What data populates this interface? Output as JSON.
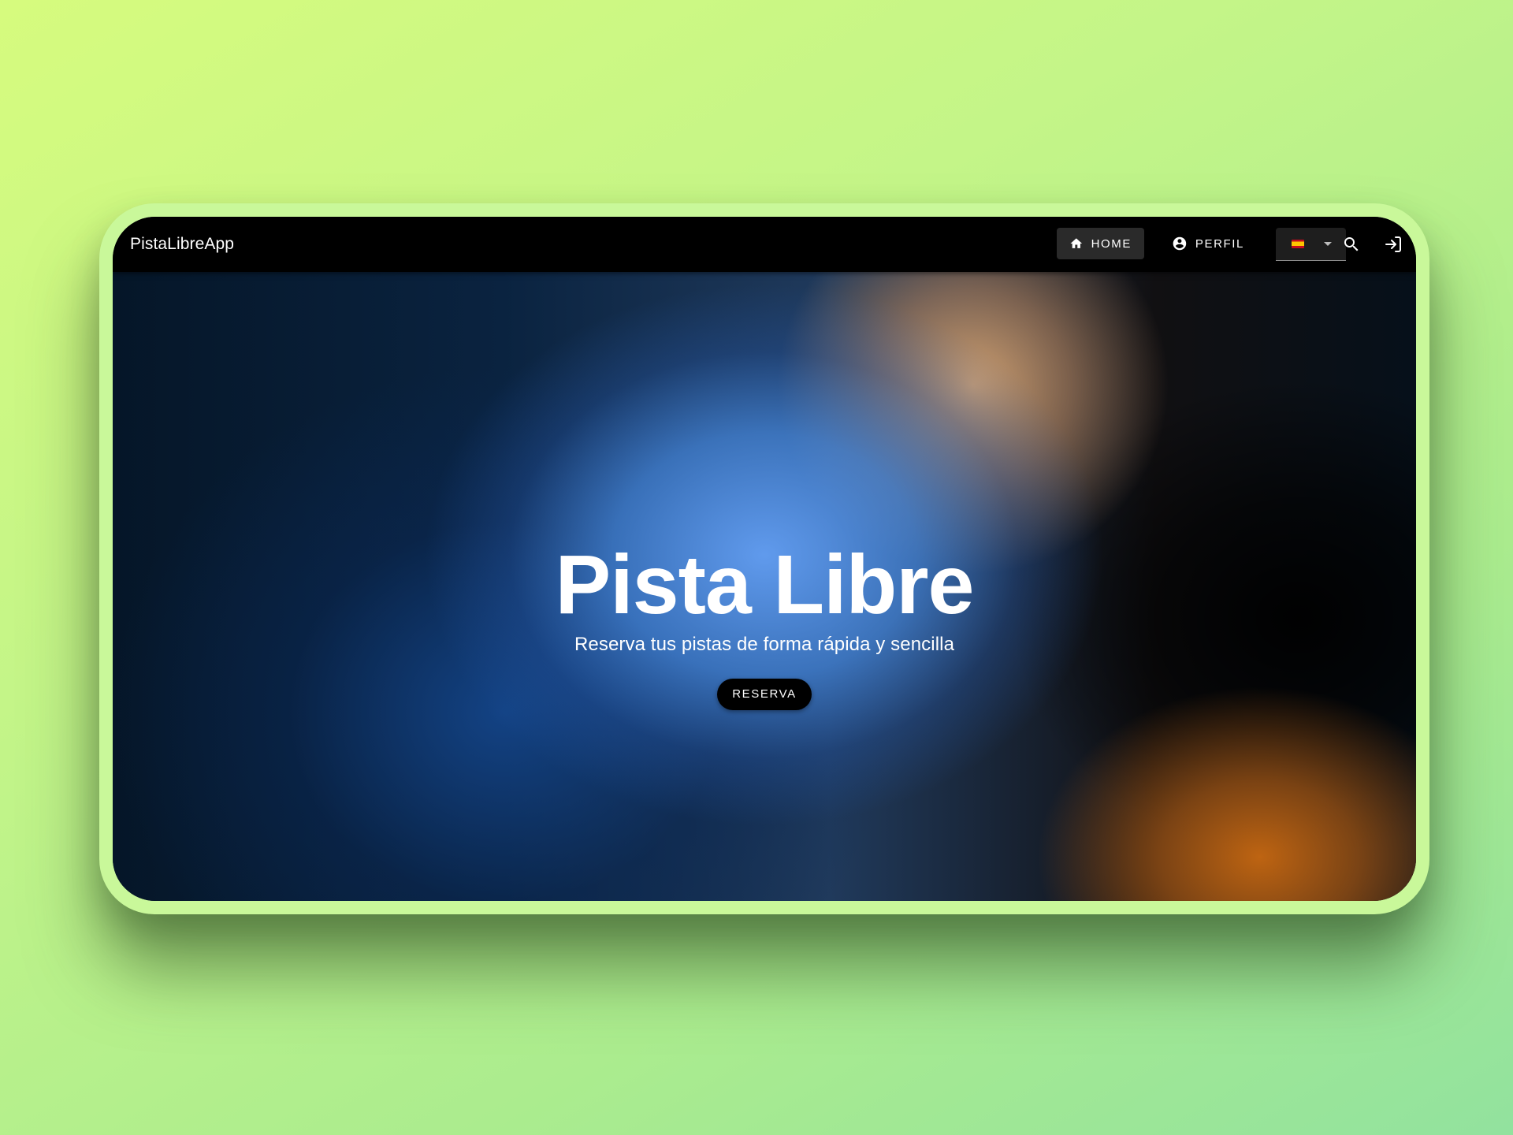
{
  "navbar": {
    "brand": "PistaLibreApp",
    "home_label": "HOME",
    "perfil_label": "PERFIL",
    "language": {
      "selected_flag": "es-flag",
      "flag_colors": [
        "#c60b1e",
        "#ffc400"
      ]
    },
    "icons": [
      "home-icon",
      "account-circle-icon",
      "search-icon",
      "login-icon",
      "caret-down-icon"
    ]
  },
  "hero": {
    "title": "Pista Libre",
    "subtitle": "Reserva tus pistas de forma rápida y sencilla",
    "cta_label": "RESERVA"
  },
  "colors": {
    "page_background": "#c4f588",
    "device_frame": "#c9f89a",
    "navbar": "#000000",
    "active_nav": "#2a2a2a",
    "hero_blue": "#64a0f5",
    "hero_orange": "#be6412"
  }
}
